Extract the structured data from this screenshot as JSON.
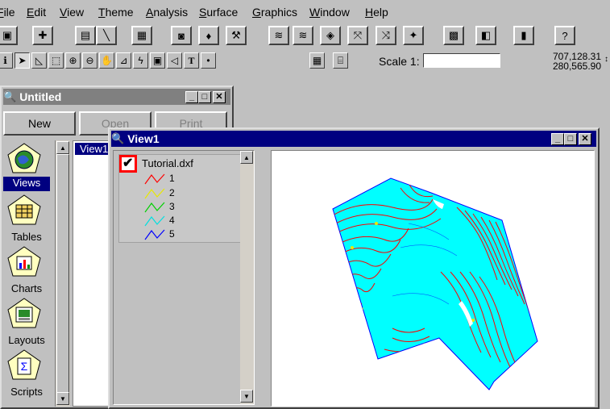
{
  "menubar": {
    "items": [
      "File",
      "Edit",
      "View",
      "Theme",
      "Analysis",
      "Surface",
      "Graphics",
      "Window",
      "Help"
    ]
  },
  "toolbar": {
    "scale_label": "Scale 1:",
    "scale_value": "",
    "coord_x": "707,128.31",
    "coord_y": "280,565.90"
  },
  "project_window": {
    "title": "Untitled",
    "buttons": [
      "New",
      "Open",
      "Print"
    ],
    "icons": [
      {
        "label": "Views",
        "icon": "globe-icon"
      },
      {
        "label": "Tables",
        "icon": "table-icon"
      },
      {
        "label": "Charts",
        "icon": "chart-icon"
      },
      {
        "label": "Layouts",
        "icon": "layout-icon"
      },
      {
        "label": "Scripts",
        "icon": "script-icon"
      }
    ],
    "list_item": "View1"
  },
  "view_window": {
    "title": "View1",
    "theme_name": "Tutorial.dxf",
    "legend": [
      {
        "label": "1",
        "color": "#ff0000"
      },
      {
        "label": "2",
        "color": "#e8e800"
      },
      {
        "label": "3",
        "color": "#00d000"
      },
      {
        "label": "4",
        "color": "#00e0e0"
      },
      {
        "label": "5",
        "color": "#0000ff"
      }
    ]
  },
  "colors": {
    "title_active": "#000080",
    "title_inactive": "#808080",
    "map_fill": "#00ffff",
    "contour_red": "#ff0000",
    "highlight": "#ff0000"
  }
}
